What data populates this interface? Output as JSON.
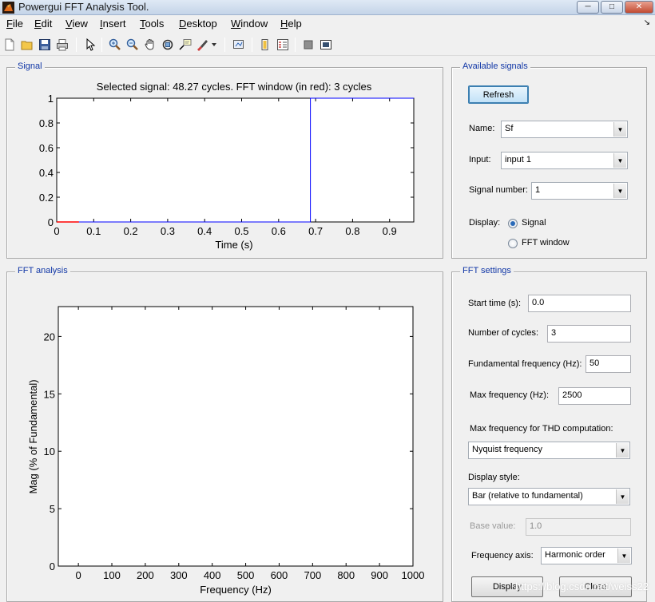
{
  "window": {
    "title": "Powergui FFT Analysis Tool."
  },
  "menu": [
    "File",
    "Edit",
    "View",
    "Insert",
    "Tools",
    "Desktop",
    "Window",
    "Help"
  ],
  "toolbar": [
    "new-figure",
    "open-file",
    "save",
    "print",
    "pointer",
    "zoom-in",
    "zoom-out",
    "pan",
    "rotate-3d",
    "data-cursor",
    "brush",
    "link-plot",
    "colorbar",
    "legend",
    "hide-plot-tools",
    "show-plot-tools"
  ],
  "signal_panel": {
    "title": "Signal",
    "chart_title": "Selected signal: 48.27 cycles. FFT window (in red): 3 cycles"
  },
  "fft_panel": {
    "title": "FFT analysis"
  },
  "available_signals": {
    "title": "Available signals",
    "refresh_label": "Refresh",
    "name_label": "Name:",
    "name_value": "Sf",
    "input_label": "Input:",
    "input_value": "input 1",
    "signal_number_label": "Signal number:",
    "signal_number_value": "1",
    "display_label": "Display:",
    "display_options": [
      "Signal",
      "FFT window"
    ],
    "display_selected": "Signal"
  },
  "fft_settings": {
    "title": "FFT settings",
    "start_time_label": "Start time (s):",
    "start_time_value": "0.0",
    "cycles_label": "Number of cycles:",
    "cycles_value": "3",
    "fundamental_label": "Fundamental frequency (Hz):",
    "fundamental_value": "50",
    "max_freq_label": "Max frequency (Hz):",
    "max_freq_value": "2500",
    "thd_label": "Max frequency for THD computation:",
    "thd_value": "Nyquist frequency",
    "display_style_label": "Display style:",
    "display_style_value": "Bar (relative to fundamental)",
    "base_value_label": "Base value:",
    "base_value_value": "1.0",
    "freq_axis_label": "Frequency axis:",
    "freq_axis_value": "Harmonic order",
    "display_button": "Display",
    "close_button": "Close"
  },
  "watermark": "https://blog.csdn.net/weiss22",
  "colors": {
    "panel_title": "#1036a6",
    "signal_line": "#0000ff",
    "fft_window": "#ff0000"
  },
  "chart_data": [
    {
      "type": "line",
      "title": "Selected signal: 48.27 cycles. FFT window (in red): 3 cycles",
      "xlabel": "Time (s)",
      "ylabel": "",
      "xlim": [
        0,
        0.9654
      ],
      "ylim": [
        0,
        1
      ],
      "xticks": [
        0,
        0.1,
        0.2,
        0.3,
        0.4,
        0.5,
        0.6,
        0.7,
        0.8,
        0.9
      ],
      "yticks": [
        0,
        0.2,
        0.4,
        0.6,
        0.8,
        1
      ],
      "series": [
        {
          "color": "#0000ff",
          "x": [
            0,
            0.686,
            0.686,
            0.9654
          ],
          "y": [
            0,
            0,
            1,
            1
          ]
        },
        {
          "color": "#ff0000",
          "x": [
            0,
            0.06
          ],
          "y": [
            0,
            0
          ]
        }
      ],
      "grid": false
    },
    {
      "type": "bar",
      "title": "",
      "xlabel": "Frequency (Hz)",
      "ylabel": "Mag (% of Fundamental)",
      "xlim": [
        -60,
        1000
      ],
      "ylim": [
        0,
        22.6
      ],
      "xticks": [
        0,
        100,
        200,
        300,
        400,
        500,
        600,
        700,
        800,
        900,
        1000
      ],
      "yticks": [
        0,
        5,
        10,
        15,
        20
      ],
      "values": [],
      "grid": false
    }
  ]
}
